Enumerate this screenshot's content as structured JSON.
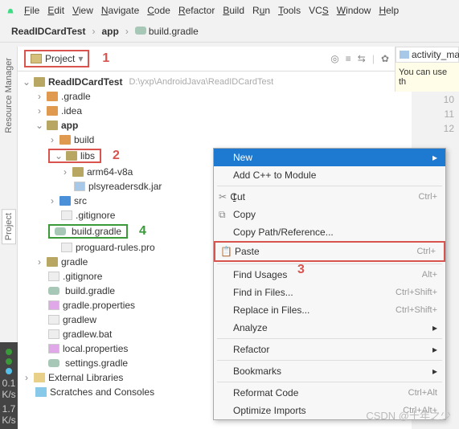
{
  "menu": [
    "File",
    "Edit",
    "View",
    "Navigate",
    "Code",
    "Refactor",
    "Build",
    "Run",
    "Tools",
    "VCS",
    "Window",
    "Help"
  ],
  "breadcrumb": {
    "proj": "ReadIDCardTest",
    "mod": "app",
    "file": "build.gradle"
  },
  "selector": "Project",
  "rightTab": "activity_ma",
  "rightHint": "You can use th",
  "gutter": [
    "10",
    "11",
    "12"
  ],
  "sideTabs": {
    "rm": "Resource Manager",
    "proj": "Project"
  },
  "metrics": {
    "a": "0.1",
    "au": "K/s",
    "b": "1.7",
    "bu": "K/s"
  },
  "ann": {
    "a1": "1",
    "a2": "2",
    "a3": "3",
    "a4": "4"
  },
  "tree": {
    "root": "ReadIDCardTest",
    "rootPath": "D:\\yxp\\AndroidJava\\ReadIDCardTest",
    "gradleFolder": ".gradle",
    "idea": ".idea",
    "app": "app",
    "build": "build",
    "libs": "libs",
    "arm": "arm64-v8a",
    "jar": "plsyreadersdk.jar",
    "src": "src",
    "gitignore": ".gitignore",
    "buildGradle": "build.gradle",
    "proguard": "proguard-rules.pro",
    "gradleF": "gradle",
    "gitignore2": ".gitignore",
    "buildGradle2": "build.gradle",
    "gradleProps": "gradle.properties",
    "gradlew": "gradlew",
    "gradlewBat": "gradlew.bat",
    "localProps": "local.properties",
    "settings": "settings.gradle",
    "extLib": "External Libraries",
    "scratches": "Scratches and Consoles"
  },
  "ctx": {
    "new": "New",
    "cpp": "Add C++ to Module",
    "cut": "Cut",
    "cutK": "Ctrl+",
    "copy": "Copy",
    "copyPath": "Copy Path/Reference...",
    "paste": "Paste",
    "pasteK": "Ctrl+",
    "findU": "Find Usages",
    "findUK": "Alt+",
    "findF": "Find in Files...",
    "findFK": "Ctrl+Shift+",
    "replaceF": "Replace in Files...",
    "replaceFK": "Ctrl+Shift+",
    "analyze": "Analyze",
    "refactor": "Refactor",
    "bookmarks": "Bookmarks",
    "reformat": "Reformat Code",
    "reformatK": "Ctrl+Alt",
    "optimize": "Optimize Imports",
    "optimizeK": "Ctrl+Alt+"
  },
  "watermark": "CSDN @十年之少"
}
